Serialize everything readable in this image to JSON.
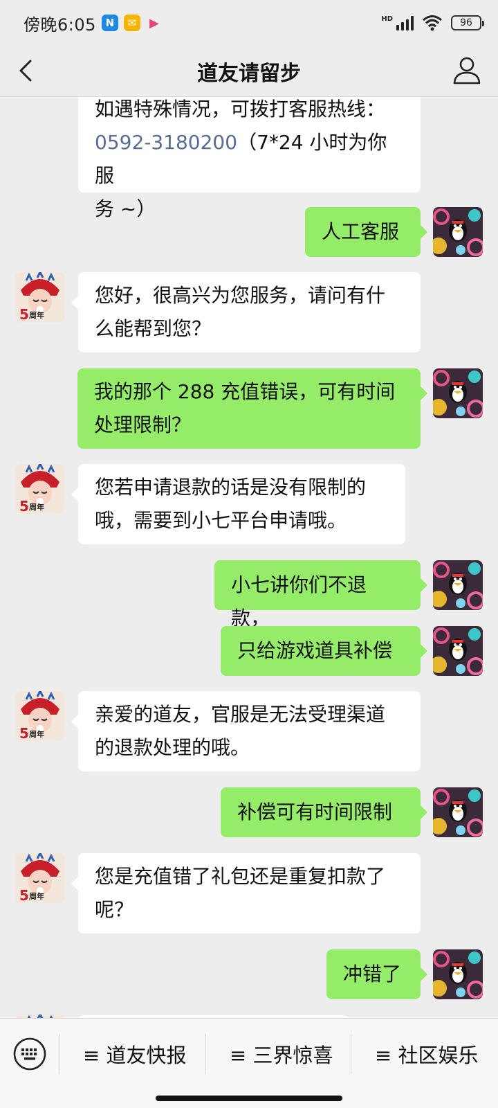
{
  "status_bar": {
    "time": "傍晚6:05",
    "app_icons": [
      "n-app-icon",
      "mail-icon",
      "play-icon"
    ],
    "network": "HD",
    "battery": "96"
  },
  "header": {
    "title": "道友请留步",
    "back_icon": "chevron-left-icon",
    "profile_icon": "person-icon"
  },
  "messages": [
    {
      "from": "bot",
      "line1": "如遇特殊情况，可拨打客服热线：",
      "link": "0592-3180200",
      "line2_rest": "（7*24 小时为你服",
      "line3": "务 ~）"
    },
    {
      "from": "user",
      "text": "人工客服"
    },
    {
      "from": "bot",
      "line1": "您好，很高兴为您服务，请问有什",
      "line2": "么能帮到您？"
    },
    {
      "from": "user",
      "line1": "我的那个 288 充值错误，可有时间",
      "line2": "处理限制？"
    },
    {
      "from": "bot",
      "line1": "您若申请退款的话是没有限制的",
      "line2": "哦，需要到小七平台申请哦。"
    },
    {
      "from": "user",
      "text": "小七讲你们不退款，"
    },
    {
      "from": "user",
      "text": "只给游戏道具补偿"
    },
    {
      "from": "bot",
      "line1": "亲爱的道友，官服是无法受理渠道",
      "line2": "的退款处理的哦。"
    },
    {
      "from": "user",
      "text": "补偿可有时间限制"
    },
    {
      "from": "bot",
      "line1": "您是充值错了礼包还是重复扣款了",
      "line2": "呢？"
    },
    {
      "from": "user",
      "text": "冲错了"
    }
  ],
  "bot_avatar_badge": "5周年",
  "bottom_menu": {
    "keyboard_icon": "keyboard-icon",
    "items": [
      "≡ 道友快报",
      "≡ 三界惊喜",
      "≡ 社区娱乐"
    ]
  },
  "colors": {
    "background": "#ededed",
    "user_bubble": "#95ec69",
    "bot_bubble": "#ffffff",
    "link": "#576b95"
  }
}
